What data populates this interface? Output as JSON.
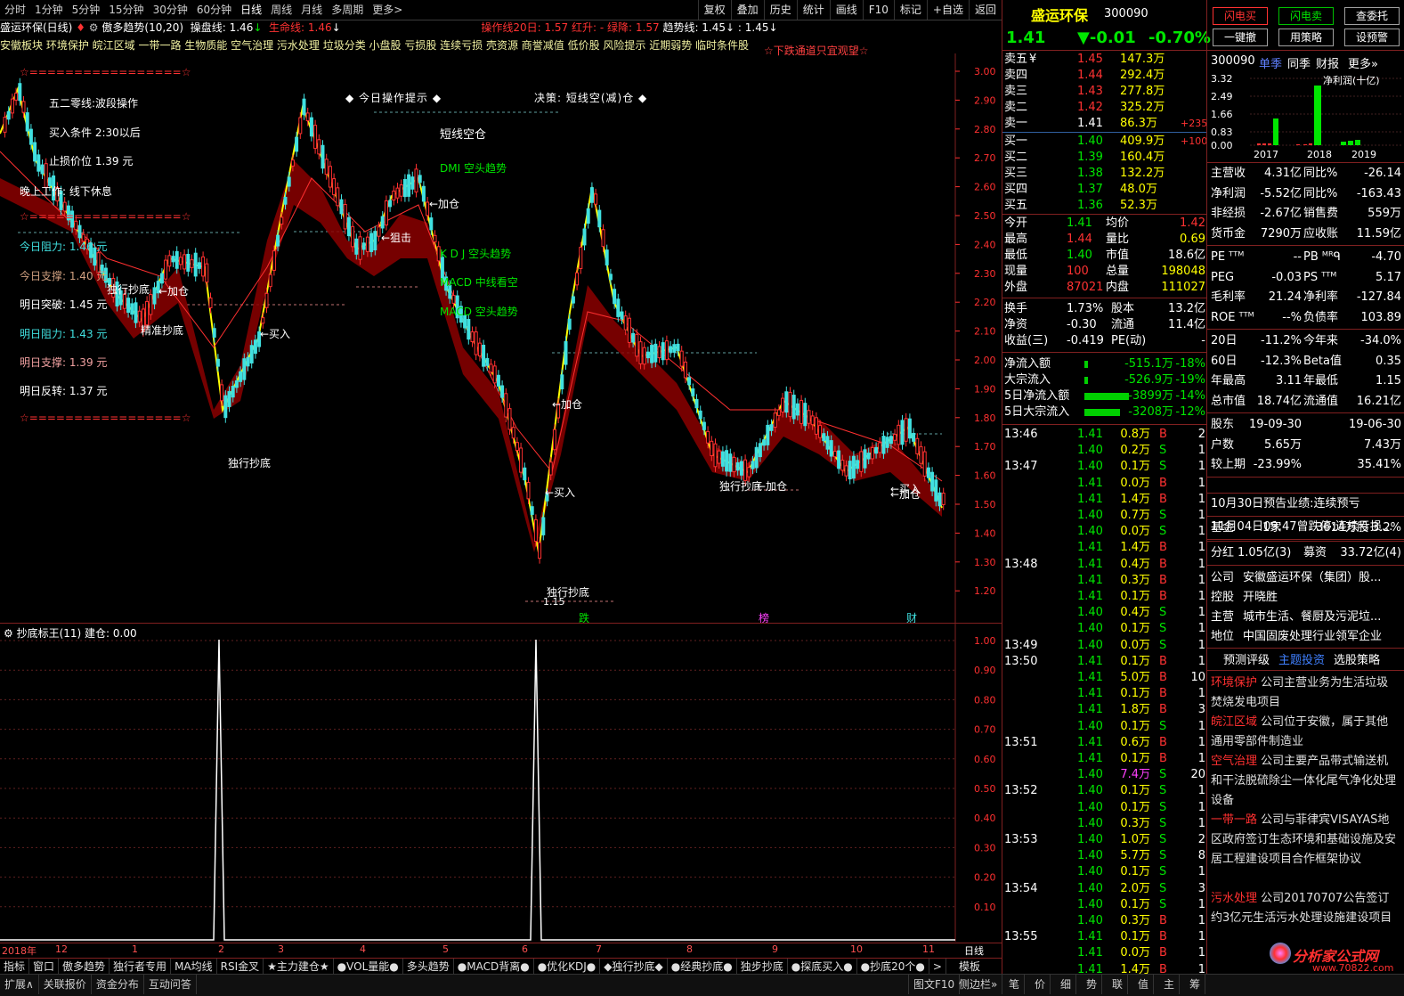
{
  "topbar": {
    "tabs": [
      "分时",
      "1分钟",
      "5分钟",
      "15分钟",
      "30分钟",
      "60分钟",
      "日线",
      "周线",
      "月线",
      "多周期",
      "更多>"
    ],
    "right_buttons": [
      "复权",
      "叠加",
      "历史",
      "统计",
      "画线",
      "F10",
      "标记",
      "+自选",
      "返回"
    ]
  },
  "indicator_line": {
    "stock": "盛运环保(日线)",
    "indicator": "傲多趋势(10,20)",
    "op_line": "操盘线: 1.46",
    "life_line": "生命线: 1.46",
    "op20": "操作线20日: 1.57",
    "red_open": "红升: -",
    "green_down": "绿降: 1.57",
    "trend_line": "趋势线: 1.45",
    "trend_val2": ": 1.45"
  },
  "blocks_text": "安徽板块 环境保护 皖江区域 一带一路 生物质能 空气治理 污水处理 垃圾分类 小盘股 亏损股 连续亏损 壳资源 商誉减值 低价股 风险提示 近期弱势 临时条件股",
  "warning": "☆下跌通道只宜观望☆",
  "strategy": {
    "stars": "☆=================☆",
    "title": "五二零线:波段操作",
    "buy_cond": "买入条件  2:30以后",
    "stop_loss": "止损价位  1.39 元",
    "work": "晚上工作: 线下休息",
    "today_resist": "今日阻力:  1.46 元",
    "today_support": "今日支撑:  1.40 元",
    "tmr_break": "明日突破:  1.45 元",
    "tmr_resist": "明日阻力:  1.43 元",
    "tmr_support": "明日支撑:  1.39 元",
    "tmr_reverse": "明日反转:  1.37 元"
  },
  "hints": {
    "today": "◆ 今日操作提示 ◆",
    "decision": "决策: 短线空(减)仓 ◆",
    "short": "短线空仓",
    "dmi": "DMI 空头趋势",
    "kdj": "K D J 空头趋势",
    "macd_mid": "MACD 中线看空",
    "macd_trend": "MACD 空头趋势"
  },
  "chart_labels": {
    "dudi1": "独行抄底",
    "dudi2": "独行抄底",
    "dudi3": "独行抄底",
    "dudi4": "独行抄底",
    "jzcd": "精准抄底",
    "buy1": "←买入",
    "buy2": "←买入",
    "buy3": "←买入",
    "add1": "←加仓",
    "add2": "←加仓",
    "add3": "←加仓",
    "add4": "←加仓",
    "add5": "←加仓",
    "zuji": "←狙击",
    "low_price": "1.15",
    "die": "跌",
    "bang": "榜",
    "cai": "财"
  },
  "price_axis": [
    "3.00",
    "2.90",
    "2.80",
    "2.70",
    "2.60",
    "2.50",
    "2.40",
    "2.30",
    "2.20",
    "2.10",
    "2.00",
    "1.90",
    "1.80",
    "1.70",
    "1.60",
    "1.50",
    "1.40",
    "1.30",
    "1.20"
  ],
  "sub_indicator": {
    "title": "抄底标王(11)  建仓: 0.00",
    "axis": [
      "1.00",
      "0.90",
      "0.80",
      "0.70",
      "0.60",
      "0.50",
      "0.40",
      "0.30",
      "0.20",
      "0.10"
    ]
  },
  "date_axis": [
    "2018年",
    "12",
    "1",
    "2",
    "3",
    "4",
    "5",
    "6",
    "7",
    "8",
    "9",
    "10",
    "11"
  ],
  "period_label": "日线",
  "bottom_tabs": [
    "指标",
    "窗口",
    "傲多趋势",
    "独行者专用",
    "MA均线",
    "RSI金叉",
    "★主力建仓★",
    "●VOL量能●",
    "多头趋势",
    "●MACD背离●",
    "●优化KDJ●",
    "◆独行抄底◆",
    "●经典抄底●",
    "独步抄底",
    "●探底买入●",
    "●抄底20个●",
    ">"
  ],
  "bottom_template": "模板",
  "status": {
    "left": [
      "扩展∧",
      "关联报价",
      "资金分布",
      "互动问答"
    ],
    "mid": [
      "图文F10",
      "侧边栏»"
    ],
    "right": [
      "笔",
      "价",
      "细",
      "势",
      "联",
      "值",
      "主",
      "筹"
    ]
  },
  "quote": {
    "name": "盛运环保",
    "code": "300090",
    "price": "1.41",
    "change": "▼-0.01",
    "pct": "-0.70%",
    "asks": [
      {
        "label": "卖五",
        "mark": "¥",
        "price": "1.45",
        "vol": "147.3万",
        "chg": ""
      },
      {
        "label": "卖四",
        "mark": "",
        "price": "1.44",
        "vol": "292.4万",
        "chg": ""
      },
      {
        "label": "卖三",
        "mark": "",
        "price": "1.43",
        "vol": "277.8万",
        "chg": ""
      },
      {
        "label": "卖二",
        "mark": "",
        "price": "1.42",
        "vol": "325.2万",
        "chg": ""
      },
      {
        "label": "卖一",
        "mark": "",
        "price": "1.41",
        "vol": "86.3万",
        "chg": "+235"
      }
    ],
    "bids": [
      {
        "label": "买一",
        "price": "1.40",
        "vol": "409.9万",
        "chg": "+100"
      },
      {
        "label": "买二",
        "price": "1.39",
        "vol": "160.4万",
        "chg": ""
      },
      {
        "label": "买三",
        "price": "1.38",
        "vol": "132.2万",
        "chg": ""
      },
      {
        "label": "买四",
        "price": "1.37",
        "vol": "48.0万",
        "chg": ""
      },
      {
        "label": "买五",
        "price": "1.36",
        "vol": "52.3万",
        "chg": ""
      }
    ],
    "stats": [
      {
        "k1": "今开",
        "v1": "1.41",
        "k2": "均价",
        "v2": "1.42"
      },
      {
        "k1": "最高",
        "v1": "1.44",
        "k2": "量比",
        "v2": "0.69"
      },
      {
        "k1": "最低",
        "v1": "1.40",
        "k2": "市值",
        "v2": "18.6亿"
      },
      {
        "k1": "现量",
        "v1": "100",
        "k2": "总量",
        "v2": "198048"
      },
      {
        "k1": "外盘",
        "v1": "87021",
        "k2": "内盘",
        "v2": "111027"
      }
    ],
    "stats2": [
      {
        "k1": "换手",
        "v1": "1.73%",
        "k2": "股本",
        "v2": "13.2亿"
      },
      {
        "k1": "净资",
        "v1": "-0.30",
        "k2": "流通",
        "v2": "11.4亿"
      },
      {
        "k1": "收益(三)",
        "v1": "-0.419",
        "k2": "PE(动)",
        "v2": "-"
      }
    ],
    "flows": [
      {
        "k": "净流入额",
        "v": "-515.1万",
        "p": "-18%"
      },
      {
        "k": "大宗流入",
        "v": "-526.9万",
        "p": "-19%"
      },
      {
        "k": "5日净流入额",
        "v": "-3899万",
        "p": "-14%"
      },
      {
        "k": "5日大宗流入",
        "v": "-3208万",
        "p": "-12%"
      }
    ],
    "ticks": [
      {
        "t": "13:46",
        "p": "1.41",
        "v": "0.8万",
        "d": "B",
        "n": "2"
      },
      {
        "t": "",
        "p": "1.40",
        "v": "0.2万",
        "d": "S",
        "n": "1"
      },
      {
        "t": "13:47",
        "p": "1.40",
        "v": "0.1万",
        "d": "S",
        "n": "1"
      },
      {
        "t": "",
        "p": "1.41",
        "v": "0.0万",
        "d": "B",
        "n": "1"
      },
      {
        "t": "",
        "p": "1.41",
        "v": "1.4万",
        "d": "B",
        "n": "1"
      },
      {
        "t": "",
        "p": "1.40",
        "v": "0.7万",
        "d": "S",
        "n": "1"
      },
      {
        "t": "",
        "p": "1.40",
        "v": "0.0万",
        "d": "S",
        "n": "1"
      },
      {
        "t": "",
        "p": "1.41",
        "v": "1.4万",
        "d": "B",
        "n": "1"
      },
      {
        "t": "13:48",
        "p": "1.41",
        "v": "0.4万",
        "d": "B",
        "n": "1"
      },
      {
        "t": "",
        "p": "1.41",
        "v": "0.3万",
        "d": "B",
        "n": "1"
      },
      {
        "t": "",
        "p": "1.41",
        "v": "0.1万",
        "d": "B",
        "n": "1"
      },
      {
        "t": "",
        "p": "1.40",
        "v": "0.4万",
        "d": "S",
        "n": "1"
      },
      {
        "t": "",
        "p": "1.40",
        "v": "0.1万",
        "d": "S",
        "n": "1"
      },
      {
        "t": "13:49",
        "p": "1.40",
        "v": "0.0万",
        "d": "S",
        "n": "1"
      },
      {
        "t": "13:50",
        "p": "1.41",
        "v": "0.1万",
        "d": "B",
        "n": "1"
      },
      {
        "t": "",
        "p": "1.41",
        "v": "5.0万",
        "d": "B",
        "n": "10"
      },
      {
        "t": "",
        "p": "1.41",
        "v": "0.1万",
        "d": "B",
        "n": "1"
      },
      {
        "t": "",
        "p": "1.41",
        "v": "1.8万",
        "d": "B",
        "n": "3"
      },
      {
        "t": "",
        "p": "1.40",
        "v": "0.1万",
        "d": "S",
        "n": "1"
      },
      {
        "t": "13:51",
        "p": "1.41",
        "v": "0.6万",
        "d": "B",
        "n": "1"
      },
      {
        "t": "",
        "p": "1.41",
        "v": "0.1万",
        "d": "B",
        "n": "1"
      },
      {
        "t": "",
        "p": "1.40",
        "v": "7.4万",
        "d": "S",
        "n": "20"
      },
      {
        "t": "13:52",
        "p": "1.40",
        "v": "0.1万",
        "d": "S",
        "n": "1"
      },
      {
        "t": "",
        "p": "1.40",
        "v": "0.1万",
        "d": "S",
        "n": "1"
      },
      {
        "t": "",
        "p": "1.40",
        "v": "0.3万",
        "d": "S",
        "n": "1"
      },
      {
        "t": "13:53",
        "p": "1.40",
        "v": "1.0万",
        "d": "S",
        "n": "2"
      },
      {
        "t": "",
        "p": "1.40",
        "v": "5.7万",
        "d": "S",
        "n": "8"
      },
      {
        "t": "",
        "p": "1.40",
        "v": "0.1万",
        "d": "S",
        "n": "1"
      },
      {
        "t": "13:54",
        "p": "1.40",
        "v": "2.0万",
        "d": "S",
        "n": "3"
      },
      {
        "t": "",
        "p": "1.40",
        "v": "0.1万",
        "d": "S",
        "n": "1"
      },
      {
        "t": "",
        "p": "1.40",
        "v": "0.3万",
        "d": "B",
        "n": "1"
      },
      {
        "t": "13:55",
        "p": "1.41",
        "v": "0.1万",
        "d": "B",
        "n": "1"
      },
      {
        "t": "",
        "p": "1.41",
        "v": "0.0万",
        "d": "B",
        "n": "1"
      },
      {
        "t": "",
        "p": "1.41",
        "v": "1.4万",
        "d": "B",
        "n": "1"
      }
    ]
  },
  "f10": {
    "buttons": [
      "闪电买",
      "闪电卖",
      "查委托",
      "一键撤",
      "用策略",
      "设预警"
    ],
    "code": "300090",
    "tabs": [
      "单季",
      "同季",
      "财报",
      "更多»"
    ],
    "chart_title": "净利润(十亿)",
    "chart_yticks": [
      "3.32",
      "2.49",
      "1.66",
      "0.83",
      "0.00"
    ],
    "chart_years": [
      "2017",
      "2018",
      "2019"
    ],
    "rows": [
      {
        "k1": "主营收",
        "v1": "4.31亿",
        "k2": "同比%",
        "v2": "-26.14"
      },
      {
        "k1": "净利润",
        "v1": "-5.52亿",
        "k2": "同比%",
        "v2": "-163.43"
      },
      {
        "k1": "非经损",
        "v1": "-2.67亿",
        "k2": "销售费",
        "v2": "559万"
      },
      {
        "k1": "货币金",
        "v1": "7290万",
        "k2": "应收账",
        "v2": "11.59亿"
      }
    ],
    "rows2": [
      {
        "k1": "PE ᵀᵀᴹ",
        "v1": "--",
        "k2": "PB ᴹᴿᑫ",
        "v2": "-4.70"
      },
      {
        "k1": "PEG",
        "v1": "-0.03",
        "k2": "PS ᵀᵀᴹ",
        "v2": "5.17"
      },
      {
        "k1": "毛利率",
        "v1": "21.24",
        "k2": "净利率",
        "v2": "-127.84"
      },
      {
        "k1": "ROE ᵀᵀᴹ",
        "v1": "--%",
        "k2": "负债率",
        "v2": "103.89"
      }
    ],
    "rows3": [
      {
        "k1": "20日",
        "v1": "-11.2%",
        "k2": "今年来",
        "v2": "-34.0%"
      },
      {
        "k1": "60日",
        "v1": "-12.3%",
        "k2": "Beta值",
        "v2": "0.35"
      },
      {
        "k1": "年最高",
        "v1": "3.11",
        "k2": "年最低",
        "v2": "1.15"
      },
      {
        "k1": "总市值",
        "v1": "18.74亿",
        "k2": "流通值",
        "v2": "16.21亿"
      }
    ],
    "rows4": [
      {
        "k1": "股东",
        "v1": "19-09-30",
        "k2": "",
        "v2": "19-06-30"
      },
      {
        "k1": "户数",
        "v1": "5.65万",
        "k2": "",
        "v2": "7.43万"
      },
      {
        "k1": "较上期",
        "v1": "-23.99%",
        "k2": "",
        "v2": "35.41%"
      }
    ],
    "news1": "10月30日预告业绩:连续预亏",
    "news2": "11月04日09:47曾跌停:连续亏损...",
    "fund": {
      "k": "基金",
      "n": "1家",
      "amt": "3614万股",
      "pct": "3.2%"
    },
    "div": {
      "k": "分红",
      "v": "1.05亿(3)",
      "k2": "募资",
      "v2": "33.72亿(4)"
    },
    "company": [
      {
        "k": "公司",
        "v": "安徽盛运环保（集团）股..."
      },
      {
        "k": "控股",
        "v": "开晓胜"
      },
      {
        "k": "主营",
        "v": "城市生活、餐厨及污泥垃..."
      },
      {
        "k": "地位",
        "v": "中国固废处理行业领军企业"
      }
    ],
    "sub_tabs": [
      "预测评级",
      "主题投资",
      "选股策略"
    ],
    "themes": [
      {
        "tag": "环境保护",
        "text": "公司主营业务为生活垃圾焚烧发电项目"
      },
      {
        "tag": "皖江区域",
        "text": "公司位于安徽，属于其他通用零部件制造业"
      },
      {
        "tag": "空气治理",
        "text": "公司主要产品带式输送机和干法脱硫除尘一体化尾气净化处理设备"
      },
      {
        "tag": "一带一路",
        "text": "公司与菲律宾VISAYAS地区政府签订生态环境和基础设施及安居工程建设项目合作框架协议"
      },
      {
        "tag": "污水处理",
        "text": "公司20170707公告签订约3亿元生活污水处理设施建设项目"
      }
    ],
    "watermark": "分析家公式网",
    "watermark_url": "www.70822.com"
  }
}
